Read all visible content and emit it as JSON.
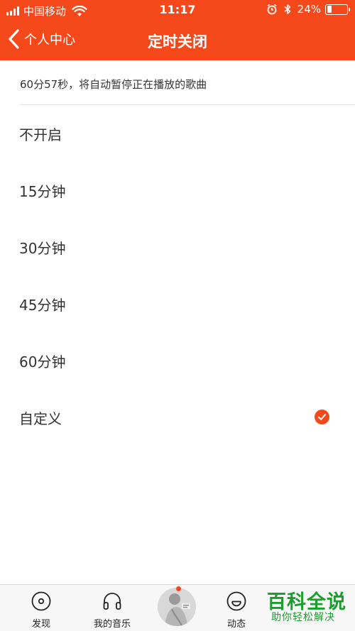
{
  "colors": {
    "accent": "#f5481b",
    "check_mark": "#ffffff"
  },
  "status_bar": {
    "carrier": "中国移动",
    "time": "11:17",
    "battery_text": "24%",
    "battery_level": 0.24,
    "icons": [
      "signal-icon",
      "wifi-icon",
      "alarm-icon",
      "bluetooth-icon",
      "battery-icon"
    ]
  },
  "nav": {
    "back_label": "个人中心",
    "title": "定时关闭"
  },
  "info": {
    "text": "60分57秒，将自动暂停正在播放的歌曲"
  },
  "options": [
    {
      "label": "不开启",
      "selected": false
    },
    {
      "label": "15分钟",
      "selected": false
    },
    {
      "label": "30分钟",
      "selected": false
    },
    {
      "label": "45分钟",
      "selected": false
    },
    {
      "label": "60分钟",
      "selected": false
    },
    {
      "label": "自定义",
      "selected": true
    }
  ],
  "tabbar": {
    "tabs": [
      {
        "label": "发现",
        "icon": "disc-icon"
      },
      {
        "label": "我的音乐",
        "icon": "headphones-icon"
      },
      {
        "label": "动态",
        "icon": "smile-icon"
      }
    ]
  },
  "watermark": {
    "main": "百科全说",
    "sub": "助你轻松解决"
  }
}
